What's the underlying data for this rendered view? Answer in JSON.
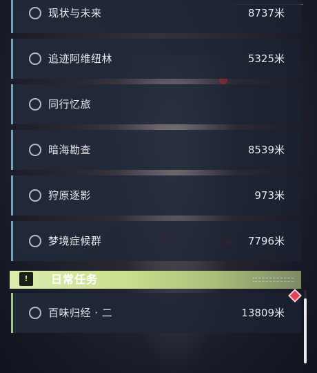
{
  "quest_list": {
    "items": [
      {
        "name": "现状与未来",
        "distance": "8737米"
      },
      {
        "name": "追迹阿维纽林",
        "distance": "5325米"
      },
      {
        "name": "同行忆旅",
        "distance": ""
      },
      {
        "name": "暗海勘查",
        "distance": "8539米"
      },
      {
        "name": "狩原逐影",
        "distance": "973米"
      },
      {
        "name": "梦境症候群",
        "distance": "7796米"
      }
    ]
  },
  "daily_section": {
    "title": "日常任务",
    "icon": "exclamation-icon",
    "items": [
      {
        "name": "百味归经 · 二",
        "distance": "13809米"
      }
    ]
  },
  "colors": {
    "main_accent": "#7fa0b4",
    "daily_accent": "#c9e08e",
    "alert": "#e0445a"
  }
}
